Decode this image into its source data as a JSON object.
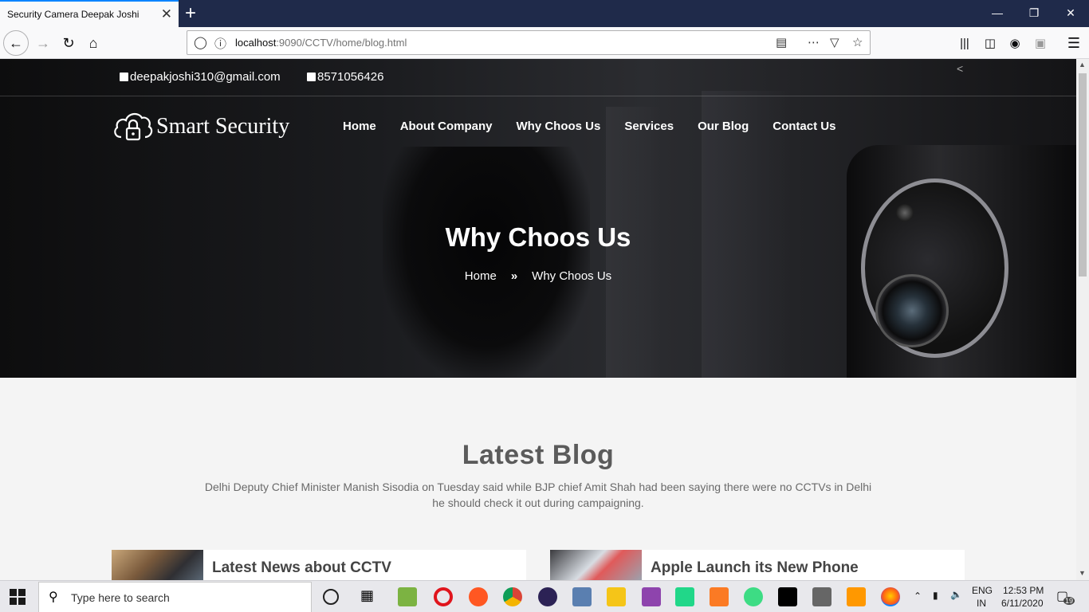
{
  "browser": {
    "tab_title": "Security Camera Deepak Joshi",
    "url_host": "localhost",
    "url_path": ":9090/CCTV/home/blog.html"
  },
  "site": {
    "email": "deepakjoshi310@gmail.com",
    "phone": "8571056426",
    "logo_text": "Smart Security",
    "nav": [
      "Home",
      "About Company",
      "Why Choos Us",
      "Services",
      "Our Blog",
      "Contact Us"
    ],
    "hero_title": "Why Choos Us",
    "breadcrumb": {
      "home": "Home",
      "current": "Why Choos Us"
    },
    "section_title": "Latest Blog",
    "section_desc": "Delhi Deputy Chief Minister Manish Sisodia on Tuesday said while BJP chief Amit Shah had been saying there were no CCTVs in Delhi he should check it out during campaigning.",
    "cards": [
      {
        "title": "Latest News about CCTV"
      },
      {
        "title": "Apple Launch its New Phone"
      }
    ]
  },
  "taskbar": {
    "search_placeholder": "Type here to search",
    "lang": "ENG",
    "region": "IN",
    "time": "12:53 PM",
    "date": "6/11/2020",
    "notifications": "19"
  },
  "colors": {
    "accent": "#0a84ff",
    "tabbar": "#1f2a4a"
  }
}
